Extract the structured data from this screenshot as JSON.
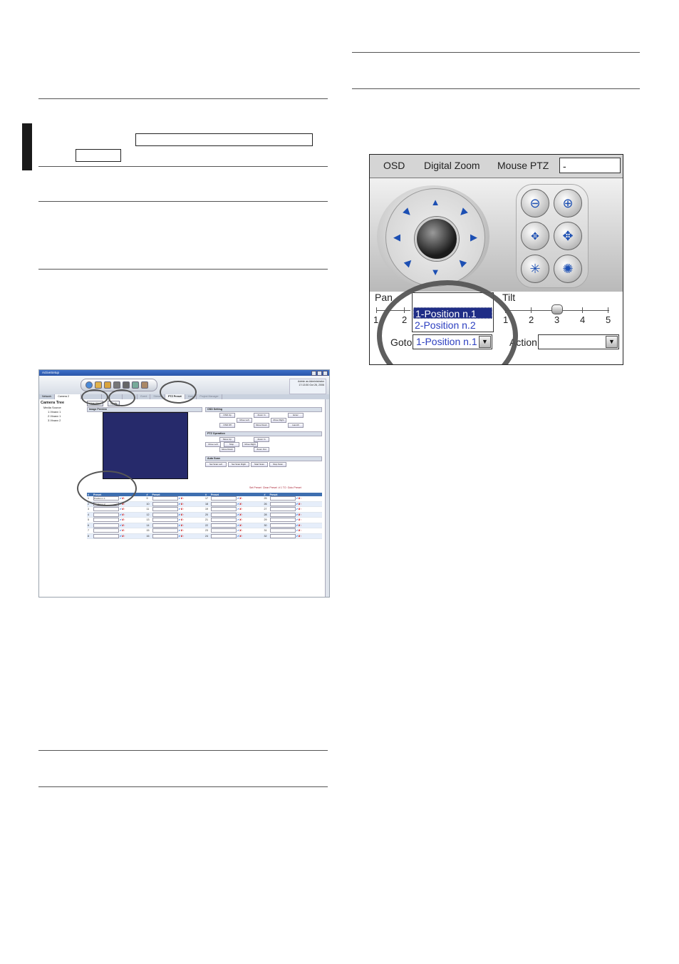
{
  "small_screenshot": {
    "window_title": "ActiveSetup",
    "admin_text": [
      "Admin as Administrator",
      "17:13:50 Oct 26, 2006"
    ],
    "network_label": "Network",
    "camera_select": "Camera 2",
    "tabs": [
      "",
      "",
      "",
      "Event",
      "Stream",
      "PTZ Preset",
      "User",
      "Project Manager"
    ],
    "tree": {
      "root": "Camera Tree",
      "source": "Media Source",
      "items": [
        "1.Vixaxx 1",
        "2.Vixaxx 1",
        "3.Vixaxx 2"
      ]
    },
    "buttons": {
      "live_view": "Live View",
      "apply": "Apply"
    },
    "panels": {
      "image_preview": "Image Preview",
      "osd_setting": "OSD Setting",
      "ptz_operation": "PTZ Operation",
      "auto_scan": "Auto Scan"
    },
    "osd_buttons": [
      "OSD Up",
      "Zoom In",
      "Enter",
      "Move Left",
      "Move Right",
      "OSD Off",
      "Move Down",
      "Launch"
    ],
    "ptz_buttons": [
      "Move Up",
      "Zoom In",
      "Move Left",
      "Stop",
      "Move Right",
      "Move Down",
      "Zoom Out"
    ],
    "scan_buttons": [
      "Set Scan Left",
      "Set Scan Right",
      "Start Scan",
      "Stop Scan"
    ],
    "links": [
      "Set Preset",
      "Clear Preset",
      "# 1 TO",
      "Goto Preset"
    ],
    "table": {
      "headers": [
        "#",
        "Preset",
        "#",
        "Preset",
        "#",
        "Preset",
        "#",
        "Preset"
      ],
      "rows": [
        [
          "1",
          "Position n.1",
          "9",
          "",
          "17",
          "",
          "25",
          ""
        ],
        [
          "2",
          "Position n.2",
          "10",
          "",
          "18",
          "",
          "26",
          ""
        ],
        [
          "3",
          "",
          "11",
          "",
          "19",
          "",
          "27",
          ""
        ],
        [
          "4",
          "",
          "12",
          "",
          "20",
          "",
          "28",
          ""
        ],
        [
          "5",
          "",
          "13",
          "",
          "21",
          "",
          "29",
          ""
        ],
        [
          "6",
          "",
          "14",
          "",
          "22",
          "",
          "30",
          ""
        ],
        [
          "7",
          "",
          "15",
          "",
          "23",
          "",
          "31",
          ""
        ],
        [
          "8",
          "",
          "16",
          "",
          "24",
          "",
          "32",
          ""
        ]
      ]
    }
  },
  "ptz_panel": {
    "top_labels": {
      "osd": "OSD",
      "digital_zoom": "Digital Zoom",
      "mouse_ptz": "Mouse PTZ"
    },
    "top_input": "-",
    "pan_label": "Pan",
    "tilt_label": "Tilt",
    "pan_scale": [
      "1",
      "2"
    ],
    "tilt_scale": [
      "1",
      "2",
      "3",
      "4",
      "5"
    ],
    "tilt_level": 3,
    "dropdown_options": [
      "1-Position n.1",
      "2-Position n.2"
    ],
    "goto_label": "Goto",
    "goto_value": "1-Position n.1",
    "action_label": "Action",
    "action_value": ""
  },
  "colors": {
    "accent": "#1c4fb3",
    "dropdown_selected": "#1f2d86",
    "preview_bg": "#262a6b",
    "table_header": "#3e6fb0"
  }
}
